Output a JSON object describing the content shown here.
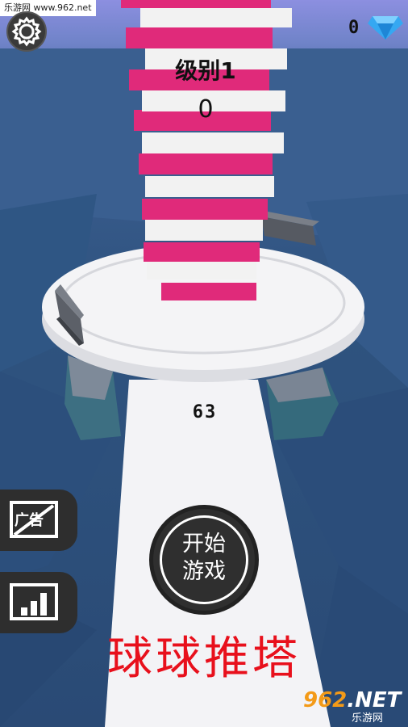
{
  "watermark_top": "乐游网 www.962.net",
  "hud": {
    "gem_count": "0",
    "gem_color": "#35a8f2",
    "level_label": "级别1",
    "score": "0",
    "distance": "63"
  },
  "buttons": {
    "settings_icon": "gear-icon",
    "no_ads_label": "广告",
    "leaderboard_icon": "bar-chart-icon",
    "start_line1": "开始",
    "start_line2": "游戏"
  },
  "game_title": "球球推塔",
  "logo": {
    "main": "962",
    "suffix": ".NET",
    "sub": "乐游网"
  },
  "colors": {
    "tower_pink": "#e02a7a",
    "tower_white": "#f2f2f2",
    "title_red": "#e8101c",
    "logo_orange": "#f39a18"
  }
}
